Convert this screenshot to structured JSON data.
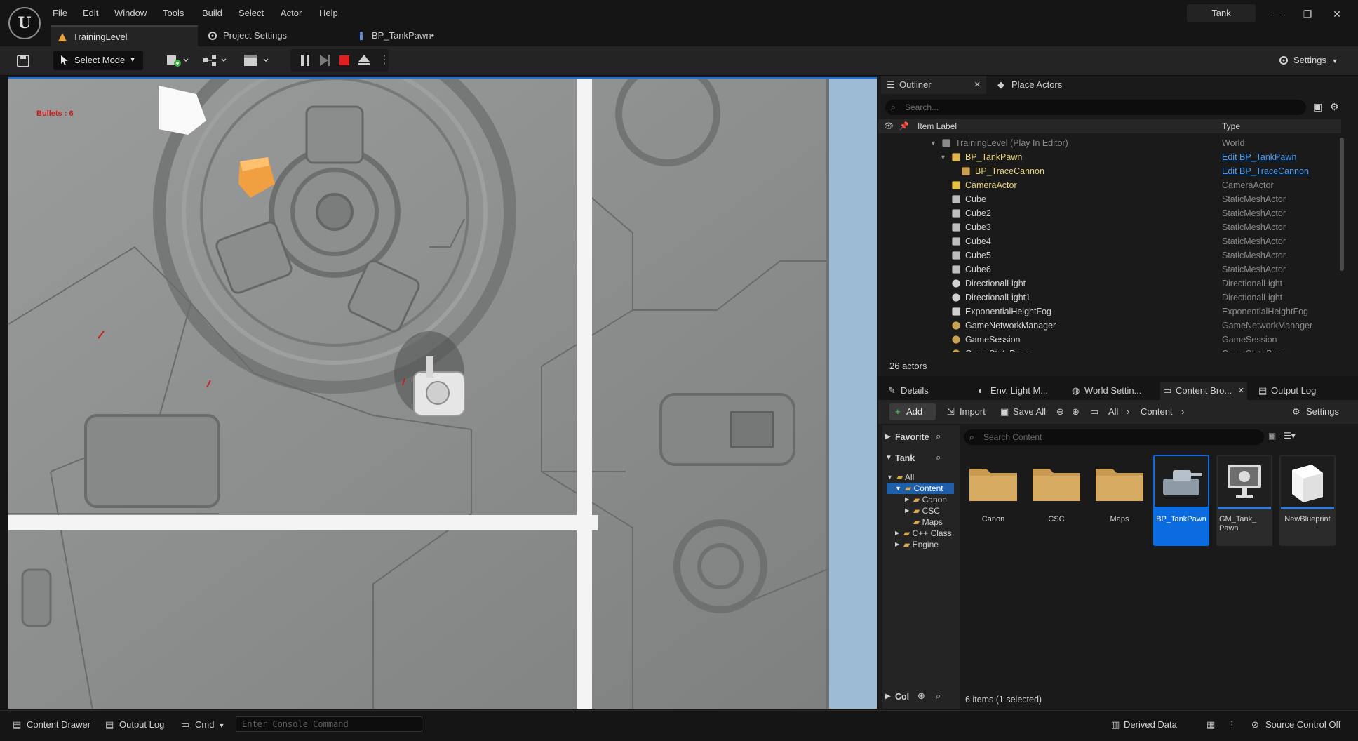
{
  "menu": [
    "File",
    "Edit",
    "Window",
    "Tools",
    "Build",
    "Select",
    "Actor",
    "Help"
  ],
  "window_title": "Tank",
  "tabs": [
    {
      "label": "TrainingLevel"
    },
    {
      "label": "Project Settings"
    },
    {
      "label": "BP_TankPawn•"
    }
  ],
  "toolbar": {
    "mode_label": "Select Mode",
    "settings_label": "Settings"
  },
  "viewport": {
    "hud_text": "Bullets : 6"
  },
  "outliner": {
    "tab_label": "Outliner",
    "other_tab_label": "Place Actors",
    "search_placeholder": "Search...",
    "col_label": "Item Label",
    "col_type": "Type",
    "rows": [
      {
        "label": "TrainingLevel (Play In Editor)",
        "type": "World",
        "icon": "level-icon"
      },
      {
        "label": "BP_TankPawn",
        "type": "Edit BP_TankPawn",
        "icon": "pawn-icon"
      },
      {
        "label": "BP_TraceCannon",
        "type": "Edit BP_TraceCannon",
        "icon": "blueprint-icon"
      },
      {
        "label": "CameraActor",
        "type": "CameraActor",
        "icon": "camera-icon"
      },
      {
        "label": "Cube",
        "type": "StaticMeshActor",
        "icon": "mesh-icon"
      },
      {
        "label": "Cube2",
        "type": "StaticMeshActor",
        "icon": "mesh-icon"
      },
      {
        "label": "Cube3",
        "type": "StaticMeshActor",
        "icon": "mesh-icon"
      },
      {
        "label": "Cube4",
        "type": "StaticMeshActor",
        "icon": "mesh-icon"
      },
      {
        "label": "Cube5",
        "type": "StaticMeshActor",
        "icon": "mesh-icon"
      },
      {
        "label": "Cube6",
        "type": "StaticMeshActor",
        "icon": "mesh-icon"
      },
      {
        "label": "DirectionalLight",
        "type": "DirectionalLight",
        "icon": "light-icon"
      },
      {
        "label": "DirectionalLight1",
        "type": "DirectionalLight",
        "icon": "light-icon"
      },
      {
        "label": "ExponentialHeightFog",
        "type": "ExponentialHeightFog",
        "icon": "fog-icon"
      },
      {
        "label": "GameNetworkManager",
        "type": "GameNetworkManager",
        "icon": "gameobj-icon"
      },
      {
        "label": "GameSession",
        "type": "GameSession",
        "icon": "gameobj-icon"
      },
      {
        "label": "GameStateBase",
        "type": "GameStateBase",
        "icon": "gameobj-icon"
      }
    ],
    "count_text": "26 actors"
  },
  "bottom_tabs": [
    "Details",
    "Env. Light M...",
    "World Settin...",
    "Content Bro...",
    "Output Log"
  ],
  "content_browser": {
    "add_label": "Add",
    "import_label": "Import",
    "save_all_label": "Save All",
    "path": [
      "All",
      "Content"
    ],
    "settings_label": "Settings",
    "favorites_label": "Favorite",
    "project_label": "Tank",
    "collections_label": "Col",
    "search_placeholder": "Search Content",
    "tree": [
      "All",
      "Content",
      "Canon",
      "CSC",
      "Maps",
      "C++ Class",
      "Engine"
    ],
    "assets": [
      {
        "name": "Canon",
        "kind": "folder"
      },
      {
        "name": "CSC",
        "kind": "folder"
      },
      {
        "name": "Maps",
        "kind": "folder"
      },
      {
        "name": "BP_TankPawn",
        "kind": "blueprint"
      },
      {
        "name": "GM_Tank_\nPawn",
        "kind": "gamemode"
      },
      {
        "name": "NewBlueprint",
        "kind": "blueprint"
      }
    ],
    "items_text": "6 items (1 selected)"
  },
  "statusbar": {
    "content_drawer": "Content Drawer",
    "output_log": "Output Log",
    "cmd": "Cmd",
    "console_placeholder": "Enter Console Command",
    "derived_data": "Derived Data",
    "source_control": "Source Control Off"
  },
  "colors": {
    "accent": "#0a6ce0",
    "link": "#4a9af0",
    "stop": "#e02020"
  }
}
